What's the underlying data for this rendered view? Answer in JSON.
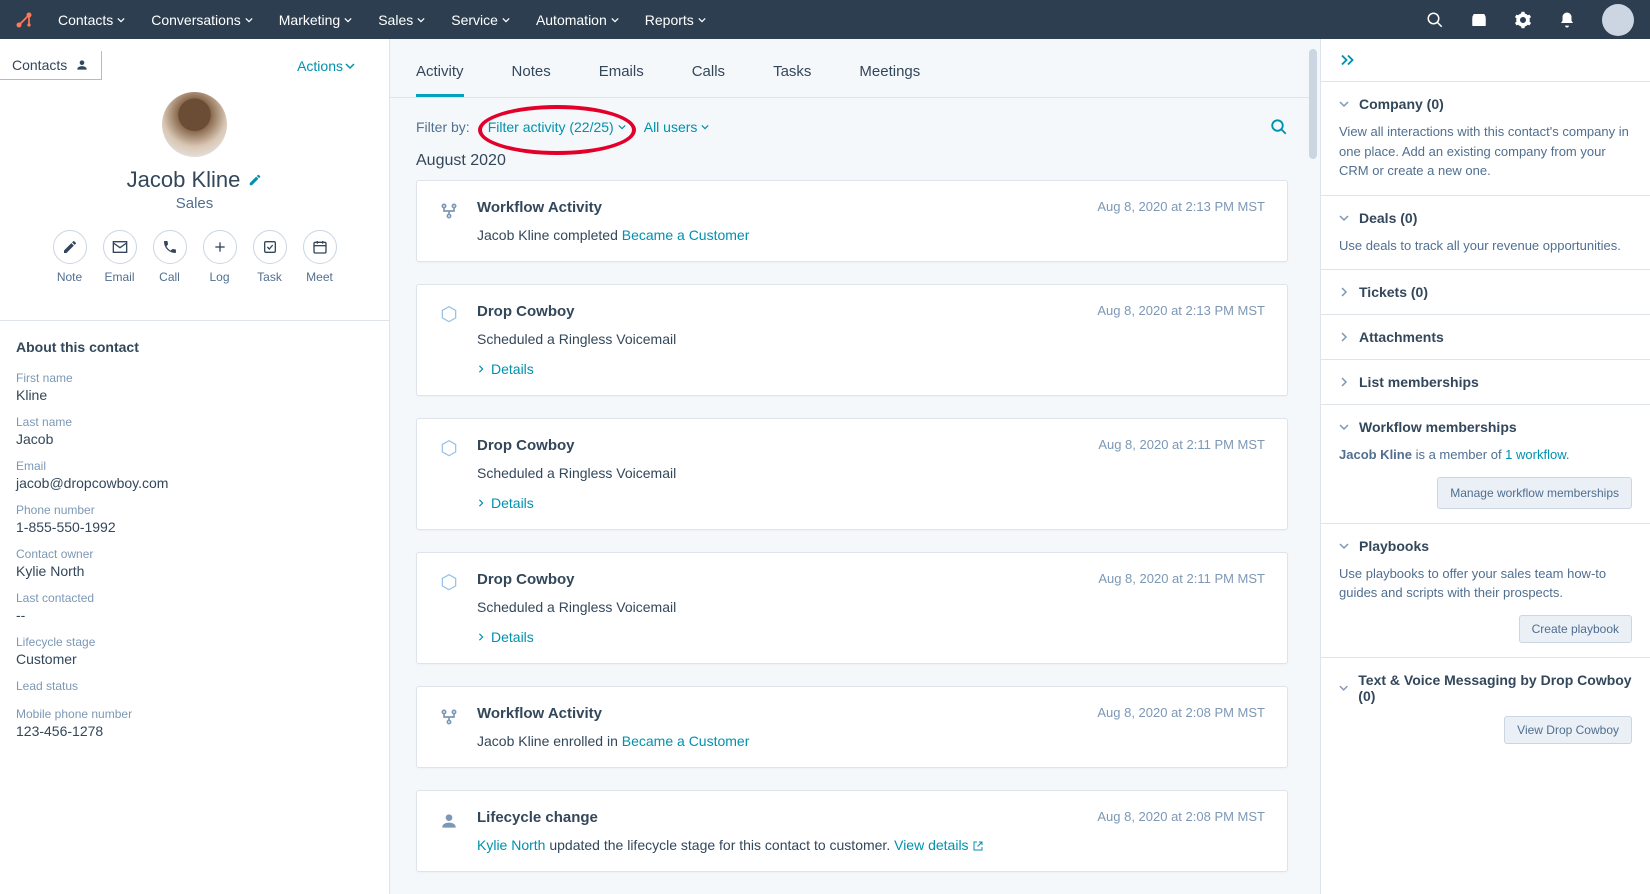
{
  "nav": {
    "items": [
      "Contacts",
      "Conversations",
      "Marketing",
      "Sales",
      "Service",
      "Automation",
      "Reports"
    ]
  },
  "left": {
    "back_label": "Contacts",
    "actions_label": "Actions",
    "name": "Jacob Kline",
    "role": "Sales",
    "action_buttons": [
      {
        "label": "Note"
      },
      {
        "label": "Email"
      },
      {
        "label": "Call"
      },
      {
        "label": "Log"
      },
      {
        "label": "Task"
      },
      {
        "label": "Meet"
      }
    ],
    "about_title": "About this contact",
    "fields": [
      {
        "label": "First name",
        "value": "Kline"
      },
      {
        "label": "Last name",
        "value": "Jacob"
      },
      {
        "label": "Email",
        "value": "jacob@dropcowboy.com"
      },
      {
        "label": "Phone number",
        "value": "1-855-550-1992"
      },
      {
        "label": "Contact owner",
        "value": "Kylie North"
      },
      {
        "label": "Last contacted",
        "value": "--"
      },
      {
        "label": "Lifecycle stage",
        "value": "Customer"
      },
      {
        "label": "Lead status",
        "value": ""
      },
      {
        "label": "Mobile phone number",
        "value": "123-456-1278"
      }
    ]
  },
  "tabs": [
    "Activity",
    "Notes",
    "Emails",
    "Calls",
    "Tasks",
    "Meetings"
  ],
  "filter": {
    "label": "Filter by:",
    "activity": "Filter activity (22/25)",
    "users": "All users"
  },
  "group_date": "August 2020",
  "details_label": "Details",
  "cards": [
    {
      "icon": "workflow",
      "title": "Workflow Activity",
      "ts": "Aug 8, 2020 at 2:13 PM MST",
      "body_pre": "Jacob Kline completed ",
      "body_link": "Became a Customer",
      "body_post": "",
      "details": false
    },
    {
      "icon": "hex",
      "title": "Drop Cowboy",
      "ts": "Aug 8, 2020 at 2:13 PM MST",
      "body_pre": "Scheduled a Ringless Voicemail",
      "body_link": "",
      "body_post": "",
      "details": true
    },
    {
      "icon": "hex",
      "title": "Drop Cowboy",
      "ts": "Aug 8, 2020 at 2:11 PM MST",
      "body_pre": "Scheduled a Ringless Voicemail",
      "body_link": "",
      "body_post": "",
      "details": true
    },
    {
      "icon": "hex",
      "title": "Drop Cowboy",
      "ts": "Aug 8, 2020 at 2:11 PM MST",
      "body_pre": "Scheduled a Ringless Voicemail",
      "body_link": "",
      "body_post": "",
      "details": true
    },
    {
      "icon": "workflow",
      "title": "Workflow Activity",
      "ts": "Aug 8, 2020 at 2:08 PM MST",
      "body_pre": "Jacob Kline  enrolled in ",
      "body_link": "Became a Customer",
      "body_post": "",
      "details": false
    },
    {
      "icon": "person",
      "title": "Lifecycle change",
      "ts": "Aug 8, 2020 at 2:08 PM MST",
      "body_pre": "",
      "body_link": "Kylie North",
      "body_post": "  updated the lifecycle stage for this contact to customer. ",
      "body_link2": "View details",
      "external": true
    }
  ],
  "right": {
    "company": {
      "title": "Company (0)",
      "body": "View all interactions with this contact's company in one place. Add an existing company from your CRM or create a new one."
    },
    "deals": {
      "title": "Deals (0)",
      "body": "Use deals to track all your revenue opportunities."
    },
    "tickets": {
      "title": "Tickets (0)"
    },
    "attachments": {
      "title": "Attachments"
    },
    "lists": {
      "title": "List memberships"
    },
    "workflow": {
      "title": "Workflow memberships",
      "body_pre": "Jacob Kline",
      "body_mid": " is a member of ",
      "body_link": "1 workflow.",
      "btn": "Manage workflow memberships"
    },
    "playbooks": {
      "title": "Playbooks",
      "body": "Use playbooks to offer your sales team how-to guides and scripts with their prospects.",
      "btn": "Create playbook"
    },
    "text_voice": {
      "title": "Text & Voice Messaging by Drop Cowboy (0)",
      "btn": "View Drop Cowboy"
    }
  }
}
